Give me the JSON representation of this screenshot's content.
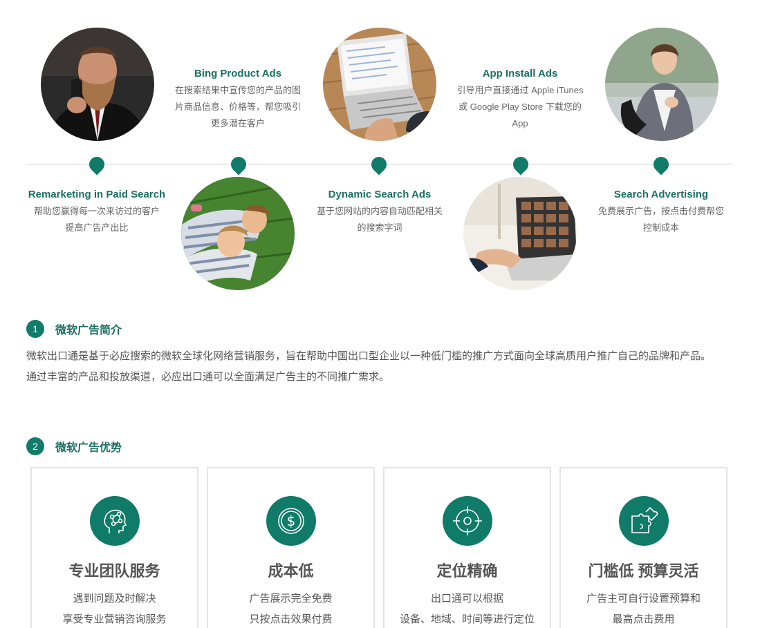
{
  "timeline": {
    "items": [
      {
        "title": "Remarketing in Paid Search",
        "desc": "帮助您赢得每一次来访过的客户提高广告产出比"
      },
      {
        "title": "Bing Product Ads",
        "desc": "在搜索结果中宣传您的产品的图片商品信息、价格等，帮您吸引更多潜在客户"
      },
      {
        "title": "Dynamic Search Ads",
        "desc": "基于您网站的内容自动匹配相关的搜索字词"
      },
      {
        "title": "App Install Ads",
        "desc": "引导用户直接通过 Apple iTunes或 Google Play Store 下载您的 App"
      },
      {
        "title": "Search Advertising",
        "desc": "免费展示广告，按点击付费帮您控制成本"
      }
    ],
    "photos": [
      "man-on-phone-photo",
      "women-lying-on-grass-photo",
      "laptop-on-desk-photo",
      "laptop-gallery-photo",
      "woman-with-phone-photo"
    ]
  },
  "section1": {
    "num": "1",
    "title": "微软广告简介",
    "para1": "微软出口通是基于必应搜索的微软全球化网络营销服务，旨在帮助中国出口型企业以一种低门槛的推广方式面向全球高质用户推广自己的品牌和产品。",
    "para2": "通过丰富的产品和投放渠道，必应出口通可以全面满足广告主的不同推广需求。"
  },
  "section2": {
    "num": "2",
    "title": "微软广告优势",
    "cards": [
      {
        "icon": "head-network-icon",
        "title": "专业团队服务",
        "line1": "遇到问题及时解决",
        "line2": "享受专业营销咨询服务"
      },
      {
        "icon": "dollar-coin-icon",
        "title": "成本低",
        "line1": "广告展示完全免费",
        "line2": "只按点击效果付费"
      },
      {
        "icon": "target-crosshair-icon",
        "title": "定位精确",
        "line1": "出口通可以根据",
        "line2": "设备、地域、时间等进行定位"
      },
      {
        "icon": "puzzle-piece-icon",
        "title": "门槛低 预算灵活",
        "line1": "广告主可自行设置预算和",
        "line2": "最高点击费用"
      }
    ]
  },
  "colors": {
    "accent": "#0f7b68",
    "title": "#1a6f62",
    "text": "#555555",
    "border": "#e4e4e4",
    "line": "#cfcfcf"
  }
}
